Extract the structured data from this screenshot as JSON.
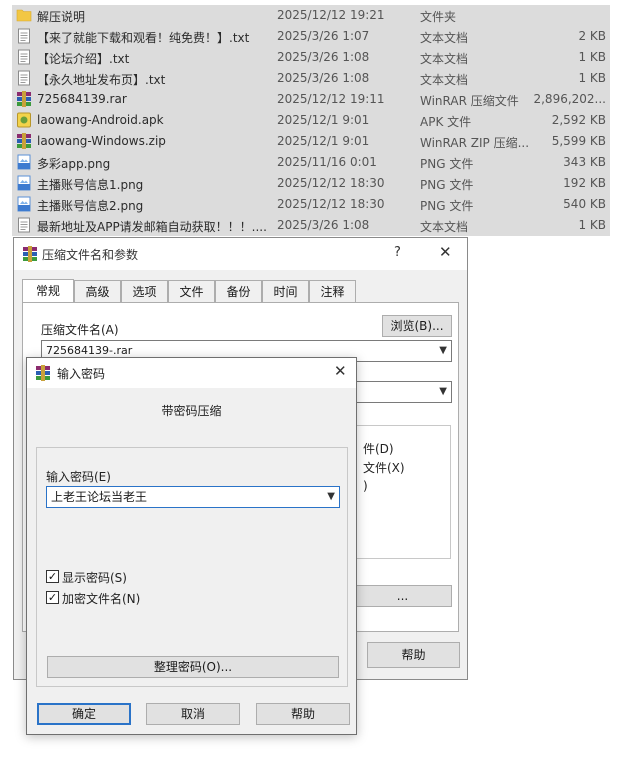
{
  "files": [
    {
      "icon": "folder-icon",
      "name": "解压说明",
      "date": "2025/12/12 19:21",
      "type": "文件夹",
      "size": ""
    },
    {
      "icon": "text-file-icon",
      "name": "【来了就能下载和观看！纯免费！】.txt",
      "date": "2025/3/26 1:07",
      "type": "文本文档",
      "size": "2 KB"
    },
    {
      "icon": "text-file-icon",
      "name": "【论坛介绍】.txt",
      "date": "2025/3/26 1:08",
      "type": "文本文档",
      "size": "1 KB"
    },
    {
      "icon": "text-file-icon",
      "name": "【永久地址发布页】.txt",
      "date": "2025/3/26 1:08",
      "type": "文本文档",
      "size": "1 KB"
    },
    {
      "icon": "winrar-archive-icon",
      "name": "725684139.rar",
      "date": "2025/12/12 19:11",
      "type": "WinRAR 压缩文件",
      "size": "2,896,202..."
    },
    {
      "icon": "apk-icon",
      "name": "laowang-Android.apk",
      "date": "2025/12/1 9:01",
      "type": "APK 文件",
      "size": "2,592 KB"
    },
    {
      "icon": "winrar-archive-icon",
      "name": "laowang-Windows.zip",
      "date": "2025/12/1 9:01",
      "type": "WinRAR ZIP 压缩...",
      "size": "5,599 KB"
    },
    {
      "icon": "png-file-icon",
      "name": "多彩app.png",
      "date": "2025/11/16 0:01",
      "type": "PNG 文件",
      "size": "343 KB"
    },
    {
      "icon": "png-file-icon",
      "name": "主播账号信息1.png",
      "date": "2025/12/12 18:30",
      "type": "PNG 文件",
      "size": "192 KB"
    },
    {
      "icon": "png-file-icon",
      "name": "主播账号信息2.png",
      "date": "2025/12/12 18:30",
      "type": "PNG 文件",
      "size": "540 KB"
    },
    {
      "icon": "text-file-icon",
      "name": "最新地址及APP请发邮箱自动获取！！！....",
      "date": "2025/3/26 1:08",
      "type": "文本文档",
      "size": "1 KB"
    }
  ],
  "archive_dialog": {
    "title": "压缩文件名和参数",
    "help_glyph": "?",
    "close_glyph": "✕",
    "tabs": [
      "常规",
      "高级",
      "选项",
      "文件",
      "备份",
      "时间",
      "注释"
    ],
    "archive_name_label": "压缩文件名(A)",
    "browse_label": "浏览(B)...",
    "archive_name_value": "725684139-.rar",
    "partial_option_1": "件(D)",
    "partial_option_2": "文件(X)",
    "partial_option_3": ")",
    "partial_button": "...",
    "help_button": "帮助"
  },
  "password_dialog": {
    "title": "输入密码",
    "close_glyph": "✕",
    "heading": "带密码压缩",
    "input_label": "输入密码(E)",
    "password_value": "上老王论坛当老王",
    "show_password_label": "显示密码(S)",
    "encrypt_names_label": "加密文件名(N)",
    "show_password_checked": true,
    "encrypt_names_checked": true,
    "check_glyph": "✓",
    "organize_button": "整理密码(O)...",
    "ok_button": "确定",
    "cancel_button": "取消",
    "help_button": "帮助"
  },
  "colors": {
    "list_background": "#dcdcdc",
    "dialog_background": "#f0f0f0",
    "primary_button_border": "#2a73c8",
    "folder": "#f2c744"
  }
}
